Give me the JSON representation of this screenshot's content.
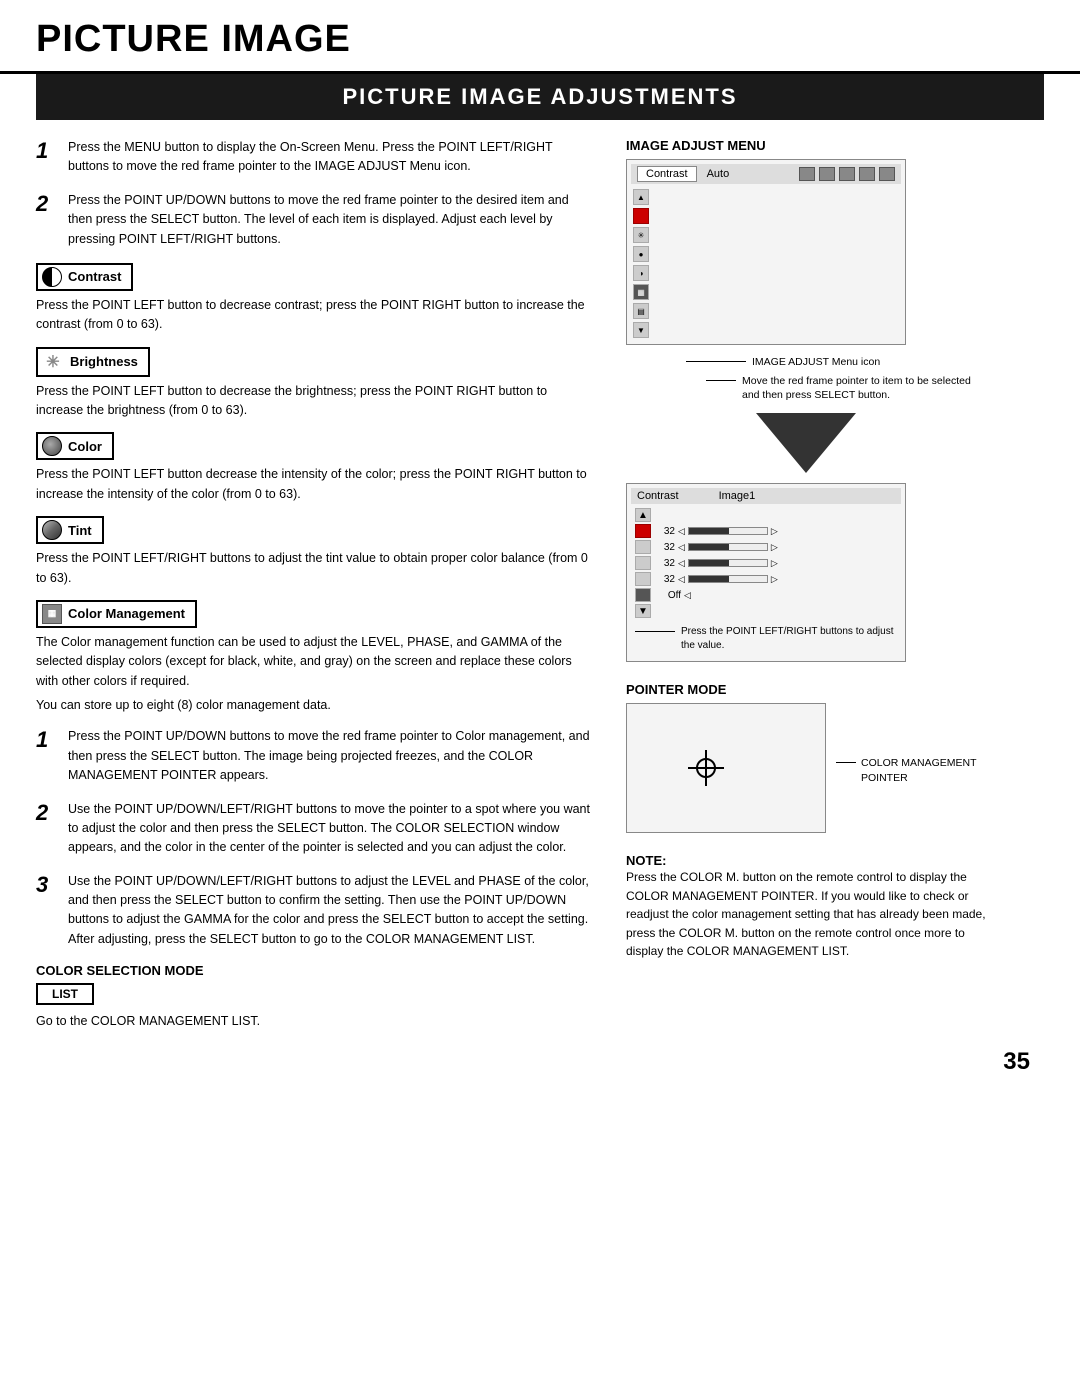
{
  "page": {
    "title": "PICTURE IMAGE",
    "section_title": "PICTURE IMAGE ADJUSTMENTS",
    "page_number": "35"
  },
  "steps": {
    "step1": "Press the MENU button to display the On-Screen Menu. Press the POINT LEFT/RIGHT buttons to move the red frame pointer to the IMAGE ADJUST Menu icon.",
    "step2": "Press the POINT UP/DOWN buttons to move the red frame pointer to the desired item and then press the SELECT button. The level of each item is displayed. Adjust each level by pressing POINT LEFT/RIGHT buttons."
  },
  "features": {
    "contrast": {
      "label": "Contrast",
      "desc": "Press the POINT LEFT button to decrease contrast; press the POINT RIGHT button to increase the contrast (from 0 to 63)."
    },
    "brightness": {
      "label": "Brightness",
      "desc": "Press the POINT LEFT button to decrease the brightness; press the POINT RIGHT button to increase the brightness (from 0 to 63)."
    },
    "color": {
      "label": "Color",
      "desc": "Press the POINT LEFT button decrease the intensity of the color; press the POINT RIGHT button to increase the intensity of the color (from 0 to 63)."
    },
    "tint": {
      "label": "Tint",
      "desc": "Press the POINT LEFT/RIGHT buttons to adjust the tint value to obtain proper color balance (from 0 to 63)."
    },
    "color_management": {
      "label": "Color Management",
      "desc1": "The Color management function can be used to adjust the LEVEL, PHASE, and GAMMA of the selected display colors (except for black, white, and gray) on the screen and replace these colors with other colors if required.",
      "desc2": "You can store up to eight (8) color management data."
    }
  },
  "color_mgmt_steps": {
    "step1": "Press the POINT UP/DOWN buttons to move the red frame pointer to Color management, and then press the SELECT button. The image being projected freezes, and the COLOR MANAGEMENT POINTER appears.",
    "step2": "Use the POINT UP/DOWN/LEFT/RIGHT buttons to move the pointer to a spot where you want to adjust the color and then press the SELECT button. The COLOR SELECTION window appears, and the color in the center of the pointer is selected and you can adjust the color.",
    "step3": "Use the POINT UP/DOWN/LEFT/RIGHT buttons to adjust the LEVEL and PHASE of the color, and then press the SELECT button to confirm the setting. Then use the POINT UP/DOWN buttons to adjust the GAMMA for the color and press the SELECT button to accept the setting. After adjusting, press the SELECT button to go to the COLOR MANAGEMENT LIST."
  },
  "color_selection": {
    "title": "COLOR SELECTION MODE",
    "list_button": "LIST",
    "list_desc": "Go to the COLOR MANAGEMENT LIST."
  },
  "image_adjust_menu": {
    "title": "IMAGE ADJUST MENU",
    "top_bar_label1": "Contrast",
    "top_bar_label2": "Auto",
    "menu_icon_label": "IMAGE ADJUST Menu icon",
    "annotation": "Move the red frame pointer to item to be selected and then press SELECT button."
  },
  "adj_panel": {
    "label1": "Contrast",
    "label2": "Image1",
    "rows": [
      {
        "value": "32"
      },
      {
        "value": "32"
      },
      {
        "value": "32"
      },
      {
        "value": "32"
      },
      {
        "value": "Off"
      }
    ],
    "annotation": "Press the POINT LEFT/RIGHT buttons to adjust the value."
  },
  "pointer_mode": {
    "title": "POINTER MODE",
    "label": "COLOR MANAGEMENT\nPOINTER"
  },
  "note": {
    "title": "NOTE:",
    "text": "Press the COLOR M. button on the remote control to display the COLOR MANAGEMENT POINTER. If you would like to check or readjust the color management setting that has already been made, press the COLOR M. button on the remote control once more to display the COLOR MANAGEMENT LIST."
  }
}
